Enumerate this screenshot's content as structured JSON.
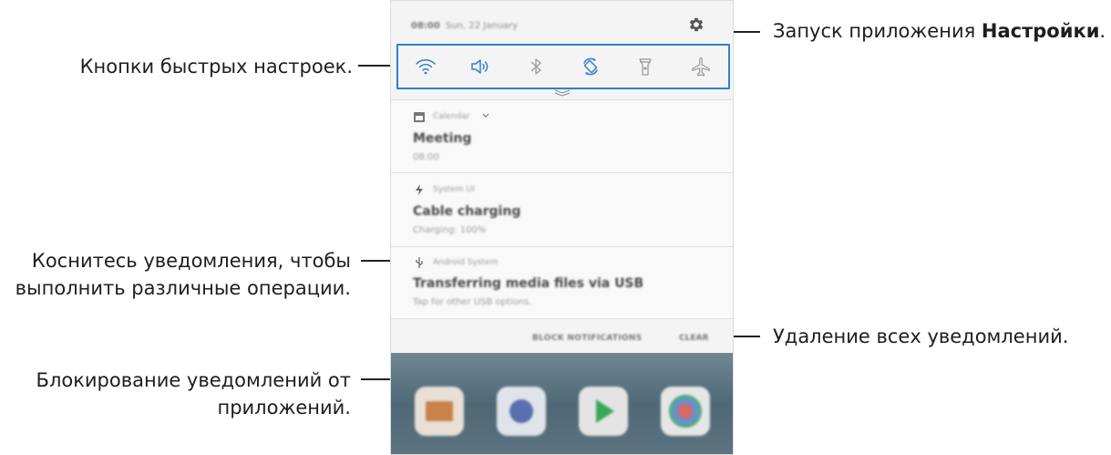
{
  "callouts": {
    "quick_settings": "Кнопки быстрых настроек.",
    "settings_prefix": "Запуск приложения ",
    "settings_bold": "Настройки",
    "settings_suffix": ".",
    "notification_line1": "Коснитесь уведомления, чтобы",
    "notification_line2": "выполнить различные операции.",
    "clear_all": "Удаление всех уведомлений.",
    "block_line1": "Блокирование уведомлений от",
    "block_line2": "приложений."
  },
  "status_bar": {
    "time": "08:00",
    "date": "Sun, 22 January"
  },
  "quick_settings": [
    "wifi-icon",
    "sound-icon",
    "bluetooth-icon",
    "auto-rotate-icon",
    "flashlight-icon",
    "airplane-mode-icon"
  ],
  "notifications": [
    {
      "app": "Calendar",
      "title": "Meeting",
      "subtitle": "08:00",
      "icon": "calendar-icon"
    },
    {
      "app": "System UI",
      "title": "Cable charging",
      "subtitle": "Charging: 100%",
      "icon": "lightning-icon"
    },
    {
      "app": "Android System",
      "title": "Transferring media files via USB",
      "subtitle": "Tap for other USB options.",
      "icon": "usb-icon"
    }
  ],
  "actions": {
    "block": "BLOCK NOTIFICATIONS",
    "clear": "CLEAR"
  },
  "colors": {
    "accent": "#2f7fd0",
    "icon": "#2f7fd0"
  }
}
